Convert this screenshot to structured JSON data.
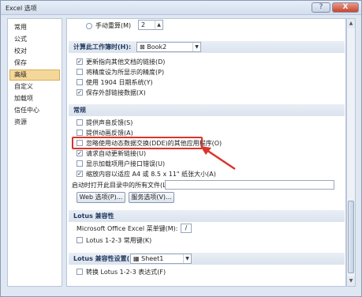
{
  "window": {
    "title": "Excel 选项",
    "help": "?",
    "close": "X"
  },
  "sidebar": {
    "items": [
      {
        "label": "常用"
      },
      {
        "label": "公式"
      },
      {
        "label": "校对"
      },
      {
        "label": "保存"
      },
      {
        "label": "高级",
        "active": true
      },
      {
        "label": "自定义"
      },
      {
        "label": "加载项"
      },
      {
        "label": "信任中心"
      },
      {
        "label": "资源"
      }
    ]
  },
  "top": {
    "manual_label": "手动重算(M)",
    "manual_value": "2"
  },
  "calc_section": {
    "header": "计算此工作簿时(H):",
    "workbook": "Book2",
    "options": [
      {
        "label": "更新指向其他文档的链接(D)",
        "checked": true
      },
      {
        "label": "将精度设为所显示的精度(P)",
        "checked": false
      },
      {
        "label": "使用 1904 日期系统(Y)",
        "checked": false
      },
      {
        "label": "保存外部链接数据(X)",
        "checked": true
      }
    ]
  },
  "general_section": {
    "header": "常规",
    "options": [
      {
        "label": "提供声音反馈(S)",
        "checked": false
      },
      {
        "label": "提供动画反馈(A)",
        "checked": false
      },
      {
        "label": "忽略使用动态数据交换(DDE)的其他应用程序(O)",
        "checked": false
      },
      {
        "label": "请求自动更新链接(U)",
        "checked": true
      },
      {
        "label": "显示加载项用户接口错误(U)",
        "checked": false
      },
      {
        "label": "缩放内容以适应 A4 或 8.5 x 11\" 纸张大小(A)",
        "checked": true
      }
    ],
    "startup_label": "启动时打开此目录中的所有文件(L):",
    "web_button": "Web 选项(P)...",
    "service_button": "服务选项(V)..."
  },
  "lotus_section": {
    "header": "Lotus 兼容性",
    "menu_key_label": "Microsoft Office Excel 菜单键(M):",
    "menu_key_value": "/",
    "option": {
      "label": "Lotus 1-2-3 常用键(K)",
      "checked": false
    }
  },
  "lotus_settings_section": {
    "header": "Lotus 兼容性设置(L):",
    "sheet": "Sheet1",
    "option": {
      "label": "转换 Lotus 1-2-3 表达式(F)",
      "checked": false
    }
  },
  "colors": {
    "highlight": "#d9352a",
    "active_nav": "#f4d79a",
    "section_header_text": "#233a5e"
  }
}
